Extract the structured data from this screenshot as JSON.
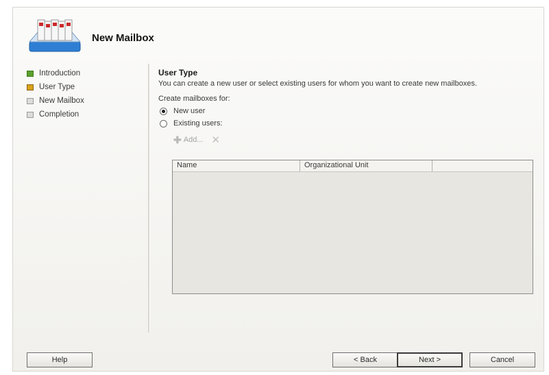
{
  "window": {
    "title": "New Mailbox",
    "icon": "mailbox-stack-icon"
  },
  "nav": {
    "items": [
      {
        "label": "Introduction",
        "state": "completed",
        "bullet_color": "#5aa02c"
      },
      {
        "label": "User Type",
        "state": "current",
        "bullet_color": "#d9a21b"
      },
      {
        "label": "New Mailbox",
        "state": "pending",
        "bullet_color": "#dcdcdc"
      },
      {
        "label": "Completion",
        "state": "pending",
        "bullet_color": "#dcdcdc"
      }
    ]
  },
  "main": {
    "section_title": "User Type",
    "description": "You can create a new user or select existing users for whom you want to create new mailboxes.",
    "create_label": "Create mailboxes for:",
    "options": [
      {
        "label": "New user",
        "selected": true
      },
      {
        "label": "Existing users:",
        "selected": false
      }
    ],
    "toolbar": {
      "add_label": "Add...",
      "add_icon": "add-plus-icon",
      "remove_icon": "remove-x-icon"
    },
    "grid": {
      "columns": [
        "Name",
        "Organizational Unit",
        ""
      ],
      "rows": []
    }
  },
  "footer": {
    "help": "Help",
    "back": "< Back",
    "next": "Next >",
    "cancel": "Cancel"
  }
}
